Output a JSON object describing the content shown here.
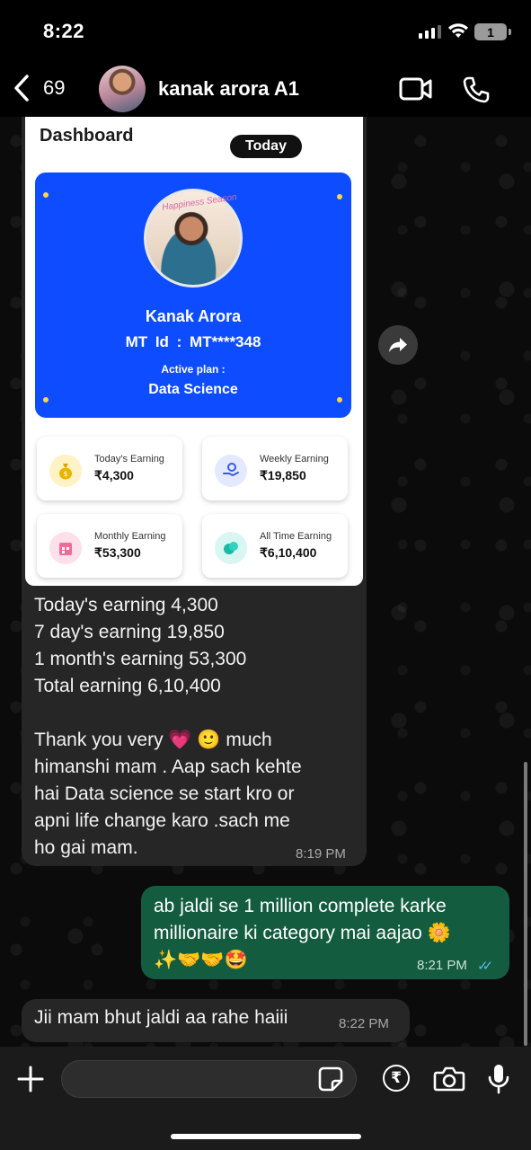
{
  "status_bar": {
    "time": "8:22",
    "battery": "1"
  },
  "header": {
    "back_count": "69",
    "contact_name": "kanak arora A1"
  },
  "dashboard": {
    "title": "Dashboard",
    "filter": "Today",
    "profile": {
      "banner": "Happiness Season",
      "name": "Kanak Arora",
      "id_text": "MT Id :  MT****348",
      "plan_label": "Active plan :",
      "plan_value": "Data Science"
    },
    "stats": [
      {
        "label": "Today's Earning",
        "value": "₹4,300",
        "icon": "money-bag-icon",
        "bg": "#fff3c4"
      },
      {
        "label": "Weekly Earning",
        "value": "₹19,850",
        "icon": "wallet-hand-icon",
        "bg": "#e3e9ff"
      },
      {
        "label": "Monthly Earning",
        "value": "₹53,300",
        "icon": "calendar-icon",
        "bg": "#ffe0ea"
      },
      {
        "label": "All Time Earning",
        "value": "₹6,10,400",
        "icon": "coins-icon",
        "bg": "#d9f7f2"
      }
    ]
  },
  "messages": {
    "incoming_1": {
      "line1": "Today's earning 4,300",
      "line2": "7 day's earning 19,850",
      "line3": "1 month's earning 53,300",
      "line4": "Total earning 6,10,400",
      "para_line1": "Thank you very 💗 🙂 much",
      "para_line2": "himanshi mam . Aap sach kehte",
      "para_line3": "hai Data science se start kro or",
      "para_line4": "apni life change karo .sach me",
      "para_line5": "ho gai mam.",
      "time": "8:19 PM"
    },
    "outgoing_1": {
      "line1": "ab jaldi se 1 million complete karke",
      "line2": "millionaire ki category mai aajao 🌼",
      "line3": "✨🤝🤝🤩",
      "time": "8:21 PM"
    },
    "incoming_2": {
      "text": "Jii mam bhut jaldi aa rahe haiii",
      "time": "8:22 PM"
    }
  },
  "composer": {
    "placeholder": "",
    "rupee_symbol": "₹"
  },
  "colors": {
    "profile_card": "#0d4dff",
    "outgoing_bubble": "#145c40",
    "incoming_bubble": "#262626",
    "read_ticks": "#53bdeb"
  }
}
